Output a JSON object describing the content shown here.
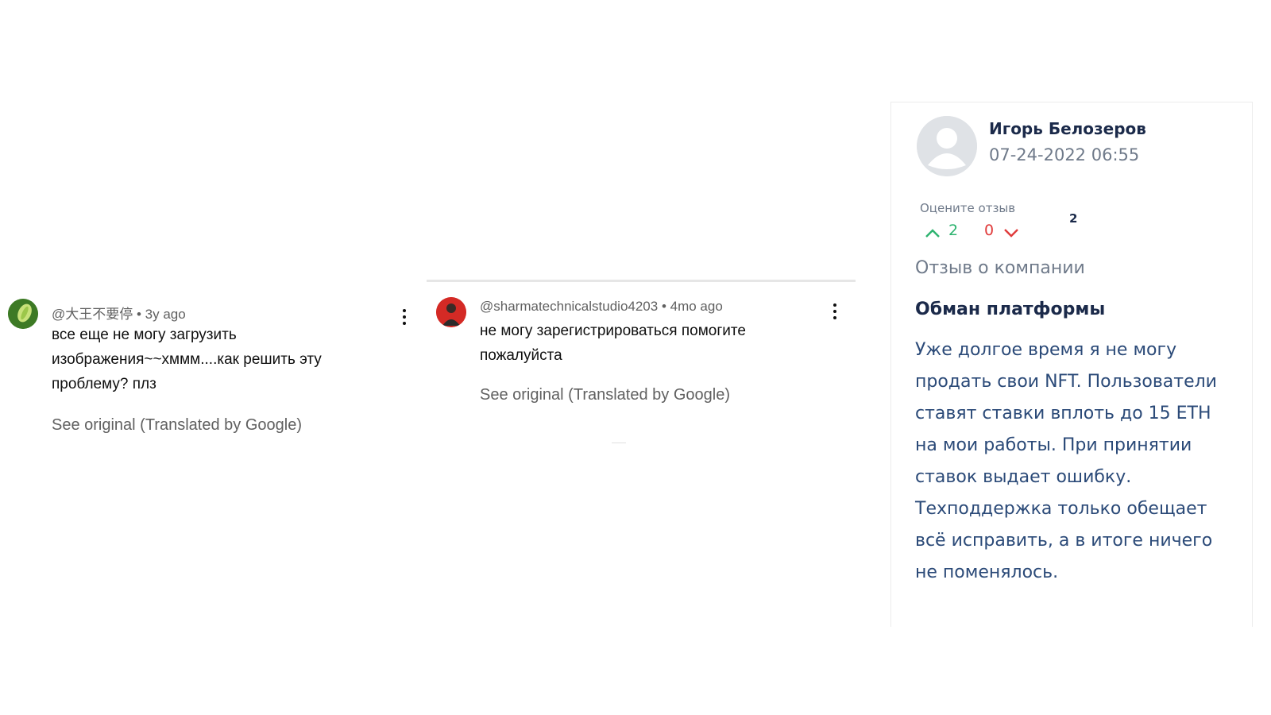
{
  "comments": [
    {
      "handle": "@大王不要停",
      "age": "3y ago",
      "text": "все еще не могу загрузить изображения~~хммм....как решить эту проблему? плз",
      "see_original": "See original (Translated by Google)",
      "avatar_icon": "leaf-avatar-icon",
      "menu_icon": "more-vert-icon"
    },
    {
      "handle": "@sharmatechnicalstudio4203",
      "age": "4mo ago",
      "text": "не могу зарегистрироваться помогите пожалуйста",
      "see_original": "See original (Translated by Google)",
      "avatar_icon": "person-avatar-icon",
      "menu_icon": "more-vert-icon"
    }
  ],
  "meta_separator": " • ",
  "review": {
    "author": "Игорь Белозеров",
    "date": "07-24-2022 06:55",
    "rate_label": "Оцените отзыв",
    "up_count": "2",
    "down_count": "0",
    "total": "2",
    "company_label": "Отзыв о компании",
    "title": "Обман платформы",
    "body": "Уже долгое время я не могу продать свои NFT. Пользователи ставят ставки вплоть до 15 ETH на мои работы. При принятии ставок выдает ошибку. Техподдержка только обещает всё исправить, а в итоге ничего не поменялось.",
    "avatar_icon": "default-user-icon",
    "upvote_icon": "chevron-up-icon",
    "downvote_icon": "chevron-down-icon"
  },
  "colors": {
    "upvote": "#2db36f",
    "downvote": "#e03b3b",
    "review_name": "#1b2a4a",
    "review_body": "#2b4a78"
  }
}
